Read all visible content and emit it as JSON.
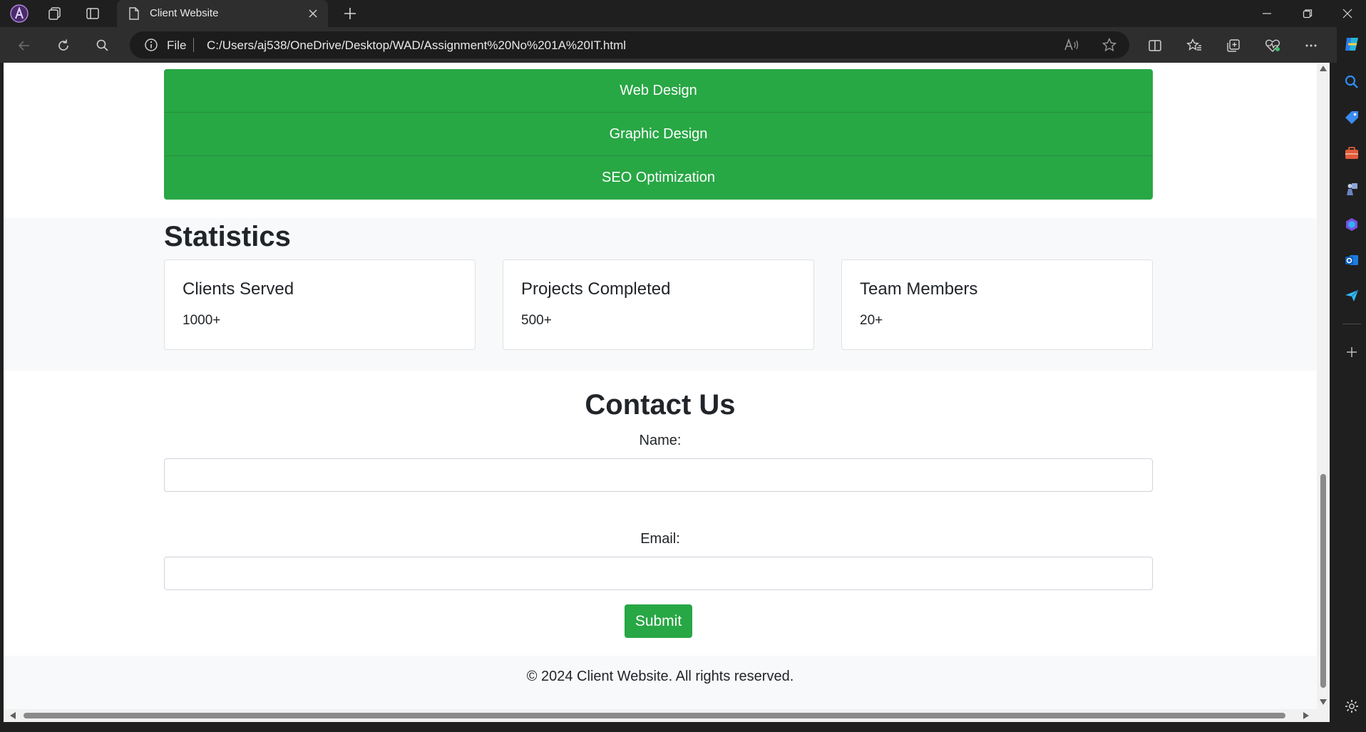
{
  "browser": {
    "tab_title": "Client Website",
    "address_prefix": "File",
    "url": "C:/Users/aj538/OneDrive/Desktop/WAD/Assignment%20No%201A%20IT.html"
  },
  "services": {
    "items": [
      "Web Design",
      "Graphic Design",
      "SEO Optimization"
    ]
  },
  "statistics": {
    "title": "Statistics",
    "cards": [
      {
        "title": "Clients Served",
        "value": "1000+"
      },
      {
        "title": "Projects Completed",
        "value": "500+"
      },
      {
        "title": "Team Members",
        "value": "20+"
      }
    ]
  },
  "contact": {
    "title": "Contact Us",
    "name_label": "Name:",
    "email_label": "Email:",
    "name_value": "",
    "email_value": "",
    "submit_label": "Submit"
  },
  "footer": {
    "text": "© 2024 Client Website. All rights reserved."
  },
  "colors": {
    "accent_green": "#28a745",
    "chrome_dark": "#1f1f1f"
  }
}
